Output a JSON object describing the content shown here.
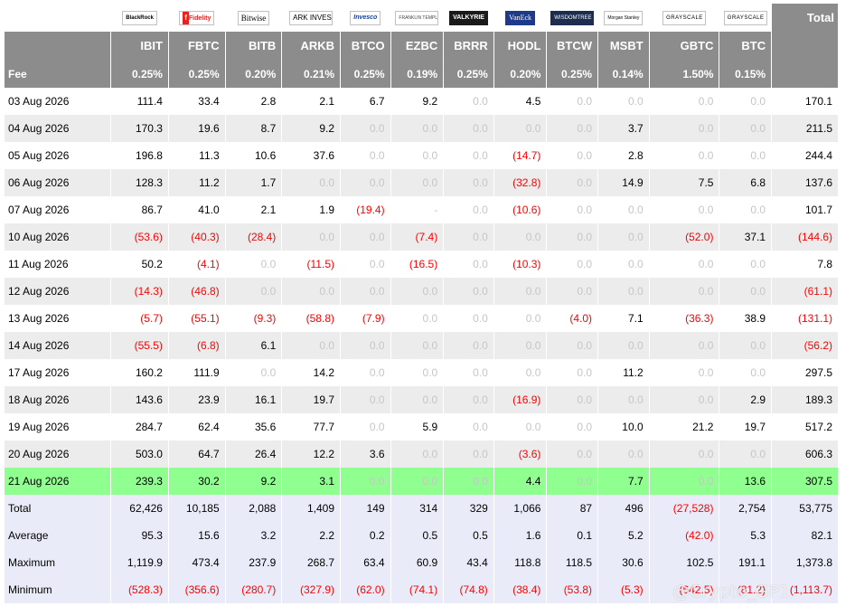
{
  "header": {
    "logos": [
      {
        "name": "BlackRock",
        "icon": "blackrock-logo-icon"
      },
      {
        "name": "Fidelity",
        "icon": "fidelity-logo-icon"
      },
      {
        "name": "Bitwise",
        "icon": "bitwise-logo-icon"
      },
      {
        "name": "ARK INVEST",
        "icon": "ark-logo-icon"
      },
      {
        "name": "Invesco",
        "icon": "invesco-logo-icon"
      },
      {
        "name": "FRANKLIN TEMPLETON",
        "icon": "franklin-logo-icon"
      },
      {
        "name": "VALKYRIE",
        "icon": "valkyrie-logo-icon"
      },
      {
        "name": "VanEck",
        "icon": "vaneck-logo-icon"
      },
      {
        "name": "WISDOMTREE",
        "icon": "wisdomtree-logo-icon"
      },
      {
        "name": "Morgan Stanley",
        "icon": "morgan-stanley-logo-icon"
      },
      {
        "name": "GRAYSCALE",
        "icon": "grayscale-logo-icon"
      },
      {
        "name": "GRAYSCALE",
        "icon": "grayscale-logo-icon"
      }
    ],
    "total_label": "Total",
    "tickers": [
      "IBIT",
      "FBTC",
      "BITB",
      "ARKB",
      "BTCO",
      "EZBC",
      "BRRR",
      "HODL",
      "BTCW",
      "MSBT",
      "GBTC",
      "BTC"
    ],
    "fee_label": "Fee",
    "fees": [
      "0.25%",
      "0.25%",
      "0.20%",
      "0.21%",
      "0.25%",
      "0.19%",
      "0.25%",
      "0.20%",
      "0.25%",
      "0.14%",
      "1.50%",
      "0.15%"
    ]
  },
  "rows": [
    {
      "date": "03 Aug 2026",
      "values": [
        "111.4",
        "33.4",
        "2.8",
        "2.1",
        "6.7",
        "9.2",
        "0.0",
        "4.5",
        "0.0",
        "0.0",
        "0.0",
        "0.0"
      ],
      "total": "170.1"
    },
    {
      "date": "04 Aug 2026",
      "values": [
        "170.3",
        "19.6",
        "8.7",
        "9.2",
        "0.0",
        "0.0",
        "0.0",
        "0.0",
        "0.0",
        "3.7",
        "0.0",
        "0.0"
      ],
      "total": "211.5"
    },
    {
      "date": "05 Aug 2026",
      "values": [
        "196.8",
        "11.3",
        "10.6",
        "37.6",
        "0.0",
        "0.0",
        "0.0",
        "(14.7)",
        "0.0",
        "2.8",
        "0.0",
        "0.0"
      ],
      "total": "244.4"
    },
    {
      "date": "06 Aug 2026",
      "values": [
        "128.3",
        "11.2",
        "1.7",
        "0.0",
        "0.0",
        "0.0",
        "0.0",
        "(32.8)",
        "0.0",
        "14.9",
        "7.5",
        "6.8"
      ],
      "total": "137.6"
    },
    {
      "date": "07 Aug 2026",
      "values": [
        "86.7",
        "41.0",
        "2.1",
        "1.9",
        "(19.4)",
        "-",
        "0.0",
        "(10.6)",
        "0.0",
        "0.0",
        "0.0",
        "0.0"
      ],
      "total": "101.7"
    },
    {
      "date": "10 Aug 2026",
      "values": [
        "(53.6)",
        "(40.3)",
        "(28.4)",
        "0.0",
        "0.0",
        "(7.4)",
        "0.0",
        "0.0",
        "0.0",
        "0.0",
        "(52.0)",
        "37.1"
      ],
      "total": "(144.6)"
    },
    {
      "date": "11 Aug 2026",
      "values": [
        "50.2",
        "(4.1)",
        "0.0",
        "(11.5)",
        "0.0",
        "(16.5)",
        "0.0",
        "(10.3)",
        "0.0",
        "0.0",
        "0.0",
        "0.0"
      ],
      "total": "7.8"
    },
    {
      "date": "12 Aug 2026",
      "values": [
        "(14.3)",
        "(46.8)",
        "0.0",
        "0.0",
        "0.0",
        "0.0",
        "0.0",
        "0.0",
        "0.0",
        "0.0",
        "0.0",
        "0.0"
      ],
      "total": "(61.1)"
    },
    {
      "date": "13 Aug 2026",
      "values": [
        "(5.7)",
        "(55.1)",
        "(9.3)",
        "(58.8)",
        "(7.9)",
        "0.0",
        "0.0",
        "0.0",
        "(4.0)",
        "7.1",
        "(36.3)",
        "38.9"
      ],
      "total": "(131.1)"
    },
    {
      "date": "14 Aug 2026",
      "values": [
        "(55.5)",
        "(6.8)",
        "6.1",
        "0.0",
        "0.0",
        "0.0",
        "0.0",
        "0.0",
        "0.0",
        "0.0",
        "0.0",
        "0.0"
      ],
      "total": "(56.2)"
    },
    {
      "date": "17 Aug 2026",
      "values": [
        "160.2",
        "111.9",
        "0.0",
        "14.2",
        "0.0",
        "0.0",
        "0.0",
        "0.0",
        "0.0",
        "11.2",
        "0.0",
        "0.0"
      ],
      "total": "297.5"
    },
    {
      "date": "18 Aug 2026",
      "values": [
        "143.6",
        "23.9",
        "16.1",
        "19.7",
        "0.0",
        "0.0",
        "0.0",
        "(16.9)",
        "0.0",
        "0.0",
        "0.0",
        "2.9"
      ],
      "total": "189.3"
    },
    {
      "date": "19 Aug 2026",
      "values": [
        "284.7",
        "62.4",
        "35.6",
        "77.7",
        "0.0",
        "5.9",
        "0.0",
        "0.0",
        "0.0",
        "10.0",
        "21.2",
        "19.7"
      ],
      "total": "517.2"
    },
    {
      "date": "20 Aug 2026",
      "values": [
        "503.0",
        "64.7",
        "26.4",
        "12.2",
        "3.6",
        "0.0",
        "0.0",
        "(3.6)",
        "0.0",
        "0.0",
        "0.0",
        "0.0"
      ],
      "total": "606.3"
    },
    {
      "date": "21 Aug 2026",
      "values": [
        "239.3",
        "30.2",
        "9.2",
        "3.1",
        "0.0",
        "0.0",
        "0.0",
        "4.4",
        "0.0",
        "7.7",
        "0.0",
        "13.6"
      ],
      "total": "307.5",
      "highlight": true
    }
  ],
  "summary": [
    {
      "label": "Total",
      "values": [
        "62,426",
        "10,185",
        "2,088",
        "1,409",
        "149",
        "314",
        "329",
        "1,066",
        "87",
        "496",
        "(27,528)",
        "2,754"
      ],
      "total": "53,775"
    },
    {
      "label": "Average",
      "values": [
        "95.3",
        "15.6",
        "3.2",
        "2.2",
        "0.2",
        "0.5",
        "0.5",
        "1.6",
        "0.1",
        "5.2",
        "(42.0)",
        "5.3"
      ],
      "total": "82.1"
    },
    {
      "label": "Maximum",
      "values": [
        "1,119.9",
        "473.4",
        "237.9",
        "268.7",
        "63.4",
        "60.9",
        "43.4",
        "118.8",
        "118.5",
        "30.6",
        "102.5",
        "191.1"
      ],
      "total": "1,373.8"
    },
    {
      "label": "Minimum",
      "values": [
        "(528.3)",
        "(356.6)",
        "(280.7)",
        "(327.9)",
        "(62.0)",
        "(74.1)",
        "(74.8)",
        "(38.4)",
        "(53.8)",
        "(5.3)",
        "(642.5)",
        "(81.2)"
      ],
      "total": "(1,113.7)"
    }
  ],
  "watermark": "@Crypto_GP1",
  "colors": {
    "header_bg": "#8c8c8c",
    "highlight_row": "#8fff8f",
    "summary_bg": "#e9ecf8",
    "negative": "#ff0000",
    "zero": "#c6c6c6",
    "alt_row": "#ececec"
  }
}
